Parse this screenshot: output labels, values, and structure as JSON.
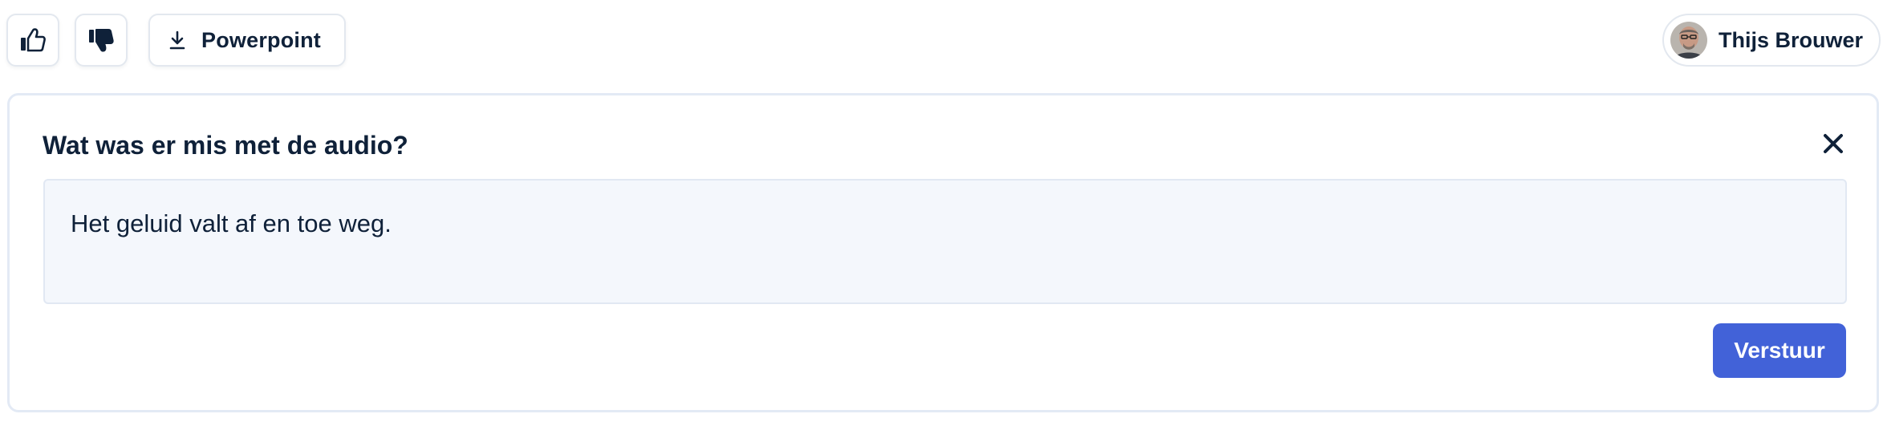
{
  "toolbar": {
    "like_icon": "thumbs-up-icon",
    "dislike_icon": "thumbs-down-filled-icon",
    "download_icon": "download-icon",
    "powerpoint_label": "Powerpoint"
  },
  "user": {
    "name": "Thijs Brouwer",
    "avatar": "user-avatar-photo"
  },
  "feedback": {
    "title": "Wat was er mis met de audio?",
    "close_icon": "close-icon",
    "text": "Het geluid valt af en toe weg.",
    "submit_label": "Verstuur"
  },
  "colors": {
    "primary": "#4262d8",
    "text": "#0f2139",
    "input_bg": "#f4f7fc",
    "border": "#e3e8ef"
  }
}
